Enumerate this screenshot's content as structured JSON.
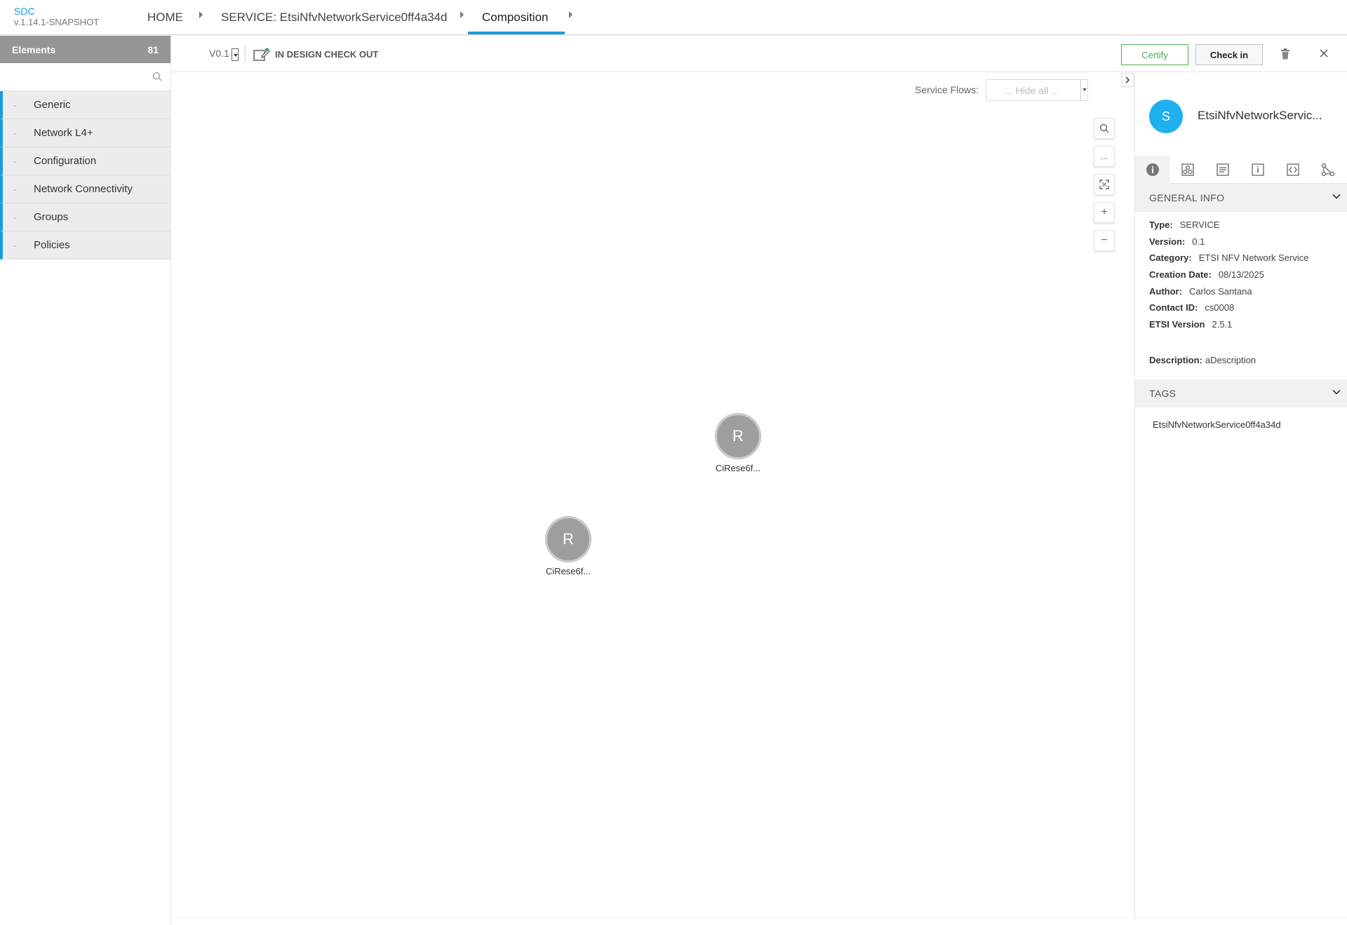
{
  "app": {
    "name": "SDC",
    "version": "v.1.14.1-SNAPSHOT"
  },
  "breadcrumb": {
    "home": "HOME",
    "service": "SERVICE: EtsiNfvNetworkService0ff4a34d",
    "current": "Composition"
  },
  "palette": {
    "title": "Elements",
    "count": "81",
    "search_placeholder": "",
    "categories": [
      {
        "dash": "-",
        "label": "Generic"
      },
      {
        "dash": "-",
        "label": "Network L4+"
      },
      {
        "dash": "-",
        "label": "Configuration"
      },
      {
        "dash": "-",
        "label": "Network Connectivity"
      },
      {
        "dash": "-",
        "label": "Groups"
      },
      {
        "dash": "-",
        "label": "Policies"
      }
    ]
  },
  "toolbar": {
    "version": "V0.1",
    "status": "IN DESIGN CHECK OUT",
    "certify_label": "Certify",
    "checkin_label": "Check in"
  },
  "canvas": {
    "service_flows_label": "Service Flows:",
    "service_flows_value": "... Hide all ...",
    "zoom_controls": {
      "more": "...",
      "zoom_in": "+",
      "zoom_out": "−"
    },
    "nodes": [
      {
        "letter": "R",
        "label": "CiRese6f..."
      },
      {
        "letter": "R",
        "label": "CiRese6f..."
      }
    ]
  },
  "panel": {
    "avatar_letter": "S",
    "title": "EtsiNfvNetworkServic...",
    "general_info": {
      "header": "GENERAL INFO",
      "type_label": "Type:",
      "type": "SERVICE",
      "version_label": "Version:",
      "version": "0.1",
      "category_label": "Category:",
      "category": "ETSI NFV Network Service",
      "creation_label": "Creation Date:",
      "creation": "08/13/2025",
      "author_label": "Author:",
      "author": "Carlos Santana",
      "contact_label": "Contact ID:",
      "contact": "cs0008",
      "etsi_label": "ETSI Version",
      "etsi": "2.5.1",
      "description_label": "Description:",
      "description": "aDescription"
    },
    "tags": {
      "header": "TAGS",
      "items": [
        "EtsiNfvNetworkService0ff4a34d"
      ]
    }
  },
  "colors": {
    "accent": "#1a9edb",
    "certify": "#4cae4c",
    "palette_header": "#959595",
    "node": "#9e9e9e",
    "avatar": "#1fb0f0"
  }
}
